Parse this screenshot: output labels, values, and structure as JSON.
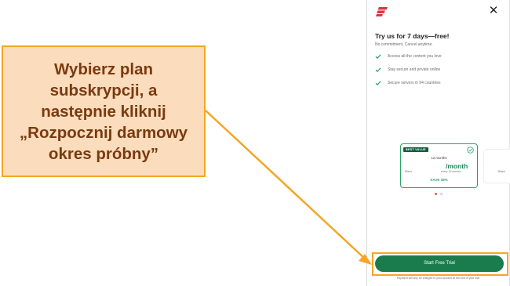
{
  "annotation": {
    "callout_text": "Wybierz plan\nsubskrypcji, a\nnastępnie kliknij\n„Rozpocznij darmowy\nokres próbny”"
  },
  "header": {
    "logo_icon": "expressvpn-logo-icon",
    "close_icon": "close-icon"
  },
  "trial": {
    "title": "Try us for 7 days—free!",
    "subtitle": "No commitment. Cancel anytime.",
    "features": [
      "Access all the content you love",
      "Stay secure and private online",
      "Secure servers in 94 countries"
    ]
  },
  "plan": {
    "badge": "BEST VALUE",
    "duration": "12 months",
    "billed_label": "Billed",
    "price_per": "/month",
    "sub": "every 12 months",
    "save": "SAVE 35%",
    "selected": true
  },
  "next_plan": {
    "billed_label": "Billed"
  },
  "carousel": {
    "pages": 2,
    "active_index": 0
  },
  "cta": {
    "label": "Start Free Trial"
  },
  "footnote": "Payment will only be charged to your account at the end of your trial",
  "colors": {
    "brand_red": "#da3940",
    "accent_green": "#1a7c4d",
    "highlight_orange": "#f5a623",
    "callout_fill": "#fbdcbd",
    "callout_text": "#7a3a10"
  }
}
